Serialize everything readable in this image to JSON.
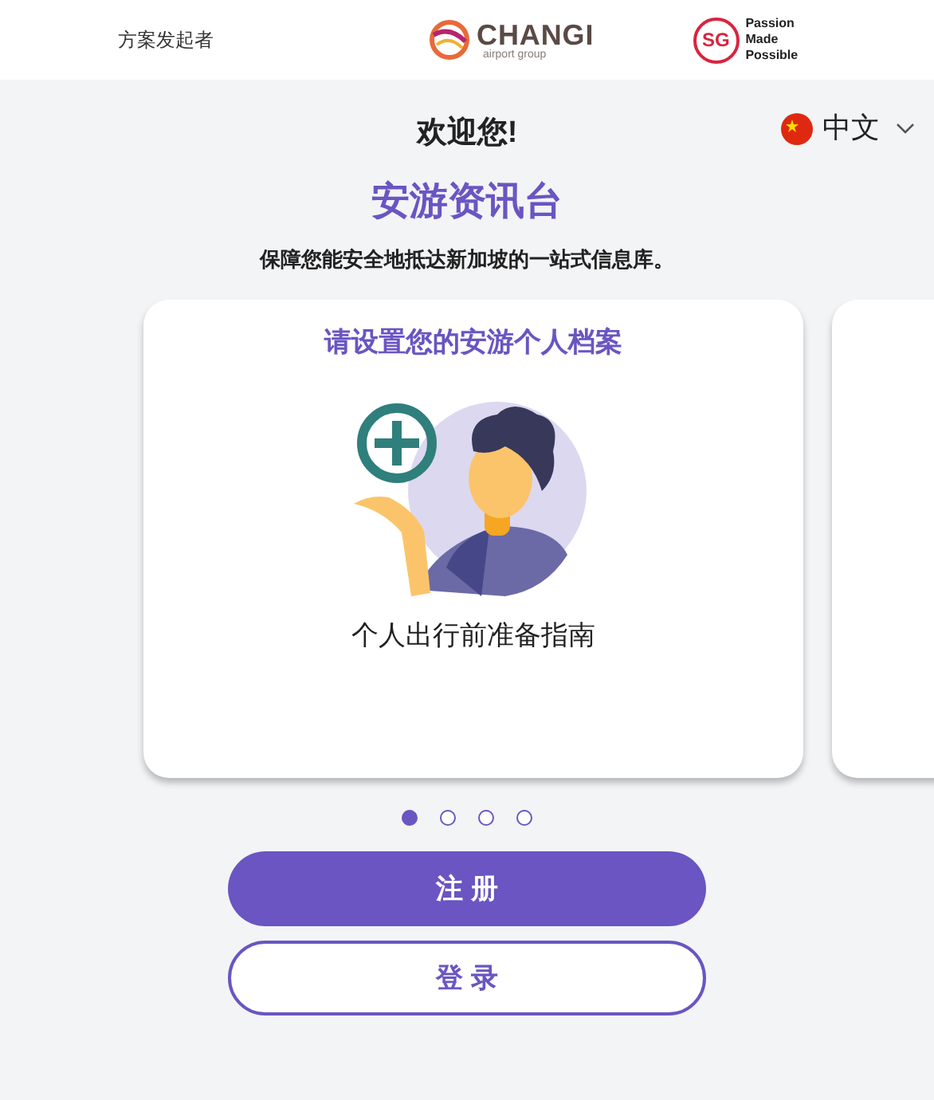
{
  "header": {
    "sponsor_label": "方案发起者",
    "changi_logo": {
      "name": "CHANGI",
      "subtitle": "airport group"
    },
    "sg_logo": {
      "mark": "SG",
      "lines": [
        "Passion",
        "Made",
        "Possible"
      ]
    }
  },
  "language": {
    "label": "中文"
  },
  "greeting": "欢迎您!",
  "title": "安游资讯台",
  "subtitle": "保障您能安全地抵达新加坡的一站式信息库。",
  "cards": [
    {
      "kind": "profile",
      "heading": "请设置您的安游个人档案",
      "caption": "个人出行前准备指南"
    },
    {
      "kind": "blank"
    }
  ],
  "dots": [
    {
      "selected": true
    },
    {
      "selected": false
    },
    {
      "selected": false
    },
    {
      "selected": false
    }
  ],
  "buttons": [
    {
      "label": "注 册",
      "kind": "primary"
    },
    {
      "label": "登 录",
      "kind": "secondary"
    }
  ]
}
